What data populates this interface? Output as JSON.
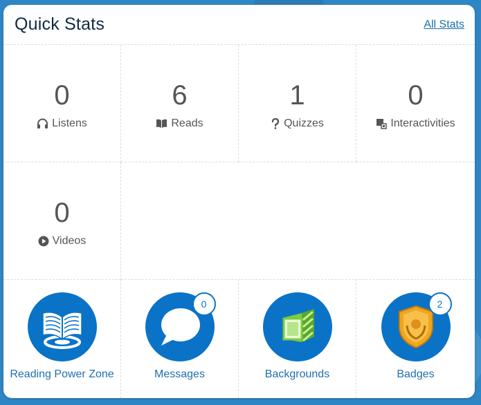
{
  "header": {
    "title": "Quick Stats",
    "all_stats_link": "All Stats"
  },
  "stats": [
    {
      "value": "0",
      "label": "Listens",
      "icon": "headphones-icon"
    },
    {
      "value": "6",
      "label": "Reads",
      "icon": "book-icon"
    },
    {
      "value": "1",
      "label": "Quizzes",
      "icon": "question-mark-icon"
    },
    {
      "value": "0",
      "label": "Interactivities",
      "icon": "puzzle-icon"
    },
    {
      "value": "0",
      "label": "Videos",
      "icon": "play-circle-icon"
    }
  ],
  "tiles": [
    {
      "label": "Reading Power Zone",
      "icon": "open-book-icon"
    },
    {
      "label": "Messages",
      "icon": "speech-bubble-icon",
      "count": "0"
    },
    {
      "label": "Backgrounds",
      "icon": "background-cube-icon"
    },
    {
      "label": "Badges",
      "icon": "shield-badge-icon",
      "count": "2"
    }
  ],
  "colors": {
    "accent": "#0a73c8",
    "link": "#1a6fa8",
    "text": "#555555",
    "title": "#112a44",
    "background": "#2f86c4"
  }
}
